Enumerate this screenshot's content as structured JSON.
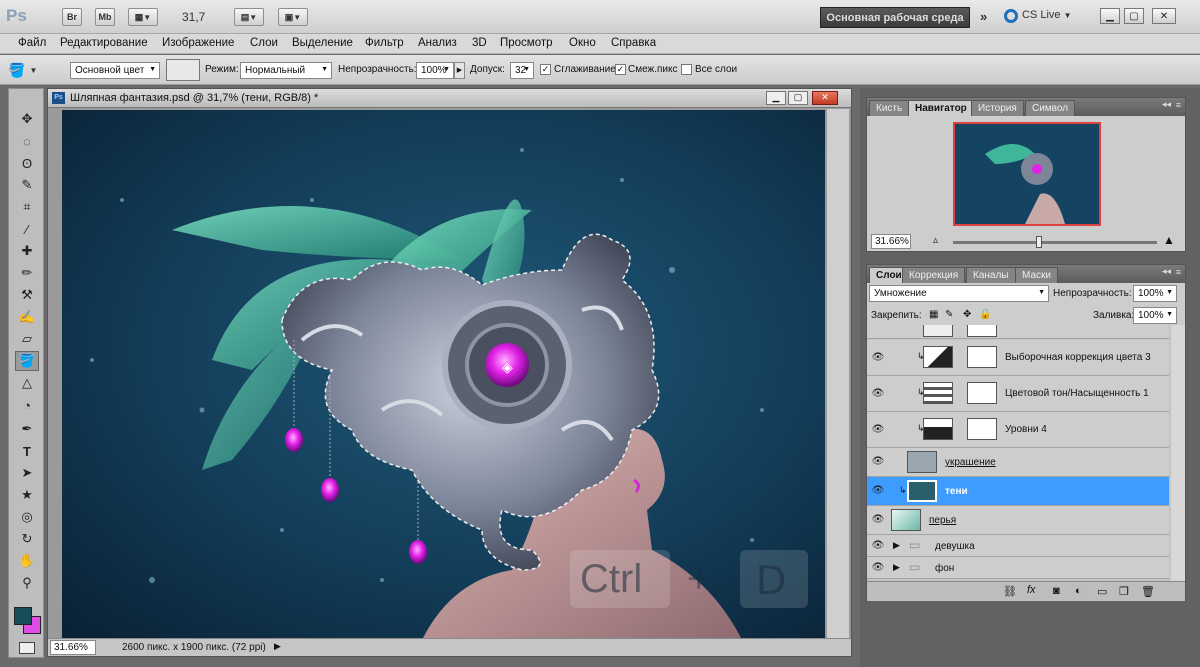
{
  "app": {
    "logo": "Ps",
    "bridge_btn": "Br",
    "minibridge_btn": "Mb",
    "zoom": "31,7",
    "workspace": "Основная рабочая среда",
    "cslive": "CS Live"
  },
  "menu": [
    "Файл",
    "Редактирование",
    "Изображение",
    "Слои",
    "Выделение",
    "Фильтр",
    "Анализ",
    "3D",
    "Просмотр",
    "Окно",
    "Справка"
  ],
  "options": {
    "fill_source": "Основной цвет",
    "mode_label": "Режим:",
    "mode_value": "Нормальный",
    "opacity_label": "Непрозрачность:",
    "opacity_value": "100%",
    "tolerance_label": "Допуск:",
    "tolerance_value": "32",
    "antialias_label": "Сглаживание",
    "contiguous_label": "Смеж.пикс",
    "all_layers_label": "Все слои"
  },
  "document": {
    "title": "Шляпная фантазия.psd @ 31,7% (тени, RGB/8) *",
    "status_zoom": "31.66%",
    "status_info": "2600 пикс. x 1900 пикс. (72 ppi)",
    "overlay_ctrl": "Ctrl",
    "overlay_plus": "+",
    "overlay_key": "D"
  },
  "navigator": {
    "tabs": [
      "Кисть",
      "Навигатор",
      "История",
      "Символ"
    ],
    "active_tab": 1,
    "zoom": "31.66%",
    "zoom_level": 0.42
  },
  "layers": {
    "tabs": [
      "Слои",
      "Коррекция",
      "Каналы",
      "Маски"
    ],
    "active_tab": 0,
    "blend_mode": "Умножение",
    "opacity_label": "Непрозрачность:",
    "opacity_value": "100%",
    "lock_label": "Закрепить:",
    "fill_label": "Заливка:",
    "fill_value": "100%",
    "items": [
      {
        "name": "Выборочная коррекция цвета 3"
      },
      {
        "name": "Цветовой тон/Насыщенность 1"
      },
      {
        "name": "Уровни 4"
      },
      {
        "name": "украшение"
      },
      {
        "name": "тени"
      },
      {
        "name": "перья"
      },
      {
        "name": "девушка"
      },
      {
        "name": "фон"
      }
    ]
  },
  "colors": {
    "selected_layer": "#3f9cff",
    "foreground": "#164d57",
    "background": "#e04ce8"
  }
}
